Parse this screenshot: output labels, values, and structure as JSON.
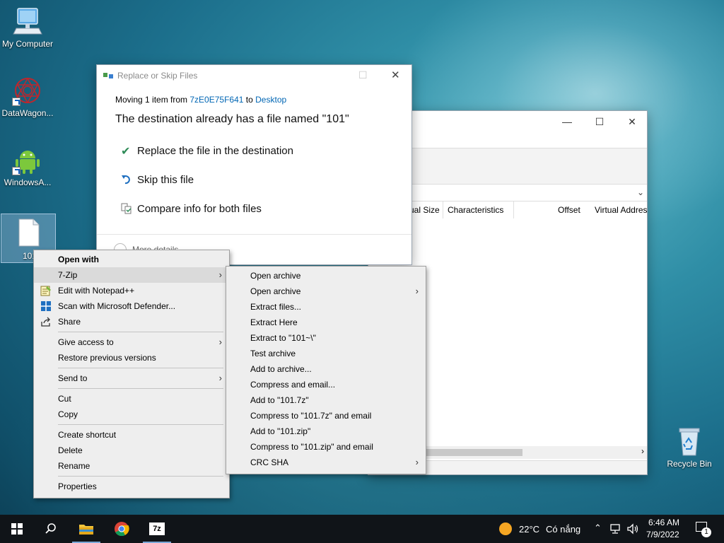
{
  "desktop": {
    "icons": [
      {
        "label": "My Computer",
        "icon": "computer-icon"
      },
      {
        "label": "DataWagon...",
        "icon": "datawagon-icon"
      },
      {
        "label": "WindowsA...",
        "icon": "android-icon"
      },
      {
        "label": "101",
        "icon": "file-icon"
      },
      {
        "label": "Recycle Bin",
        "icon": "recycle-bin-icon"
      }
    ]
  },
  "replace_dialog": {
    "title": "Replace or Skip Files",
    "moving_prefix": "Moving 1 item from",
    "source": "7zE0E75F641",
    "to_word": "to",
    "destination": "Desktop",
    "heading": "The destination already has a file named \"101\"",
    "options": [
      {
        "label": "Replace the file in the destination",
        "icon": "checkmark-icon"
      },
      {
        "label": "Skip this file",
        "icon": "skip-icon"
      },
      {
        "label": "Compare info for both files",
        "icon": "compare-icon"
      }
    ],
    "more_details": "More details"
  },
  "bg_window": {
    "columns": [
      "ual Size",
      "Characteristics",
      "Offset",
      "Virtual Addres"
    ]
  },
  "context_menu": {
    "items": [
      {
        "label": "Open with",
        "bold": true
      },
      {
        "label": "7-Zip",
        "submenu": true
      },
      {
        "label": "Edit with Notepad++",
        "icon": "notepad-icon"
      },
      {
        "label": "Scan with Microsoft Defender...",
        "icon": "defender-icon"
      },
      {
        "label": "Share",
        "icon": "share-icon"
      },
      {
        "label": "Give access to",
        "submenu": true
      },
      {
        "label": "Restore previous versions"
      },
      {
        "label": "Send to",
        "submenu": true
      },
      {
        "label": "Cut"
      },
      {
        "label": "Copy"
      },
      {
        "label": "Create shortcut"
      },
      {
        "label": "Delete"
      },
      {
        "label": "Rename"
      },
      {
        "label": "Properties"
      }
    ]
  },
  "zip_submenu": {
    "items": [
      {
        "label": "Open archive"
      },
      {
        "label": "Open archive",
        "submenu": true
      },
      {
        "label": "Extract files..."
      },
      {
        "label": "Extract Here"
      },
      {
        "label": "Extract to \"101~\\\""
      },
      {
        "label": "Test archive"
      },
      {
        "label": "Add to archive..."
      },
      {
        "label": "Compress and email..."
      },
      {
        "label": "Add to \"101.7z\""
      },
      {
        "label": "Compress to \"101.7z\" and email"
      },
      {
        "label": "Add to \"101.zip\""
      },
      {
        "label": "Compress to \"101.zip\" and email"
      },
      {
        "label": "CRC SHA",
        "submenu": true
      }
    ]
  },
  "taskbar": {
    "weather_temp": "22°C",
    "weather_text": "Có nắng",
    "time": "6:46 AM",
    "date": "7/9/2022",
    "notification_count": "1",
    "sevenzip_label": "7z"
  },
  "colors": {
    "link": "#0066b4",
    "check": "#2e8b57",
    "accent": "#0078d7"
  }
}
